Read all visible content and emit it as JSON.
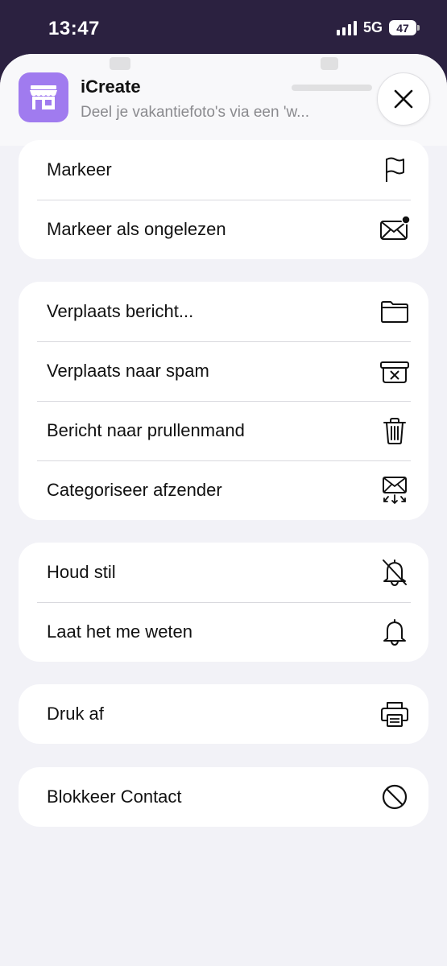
{
  "status": {
    "time": "13:47",
    "network": "5G",
    "battery": "47"
  },
  "header": {
    "app_name": "iCreate",
    "subtitle": "Deel je vakantiefoto's via een 'w..."
  },
  "groups": [
    {
      "items": [
        {
          "label": "Markeer",
          "icon": "flag-icon"
        },
        {
          "label": "Markeer als ongelezen",
          "icon": "envelope-unread-icon"
        }
      ]
    },
    {
      "items": [
        {
          "label": "Verplaats bericht...",
          "icon": "folder-icon"
        },
        {
          "label": "Verplaats naar spam",
          "icon": "junk-bin-icon"
        },
        {
          "label": "Bericht naar prullenmand",
          "icon": "trash-icon"
        },
        {
          "label": "Categoriseer afzender",
          "icon": "envelope-categorize-icon"
        }
      ]
    },
    {
      "items": [
        {
          "label": "Houd stil",
          "icon": "bell-slash-icon"
        },
        {
          "label": "Laat het me weten",
          "icon": "bell-icon"
        }
      ]
    },
    {
      "items": [
        {
          "label": "Druk af",
          "icon": "printer-icon"
        }
      ]
    },
    {
      "items": [
        {
          "label": "Blokkeer Contact",
          "icon": "block-icon"
        }
      ]
    }
  ],
  "colors": {
    "app_icon": "#a07bef",
    "sheet_bg": "#f2f2f7",
    "backdrop": "#2b2140"
  }
}
